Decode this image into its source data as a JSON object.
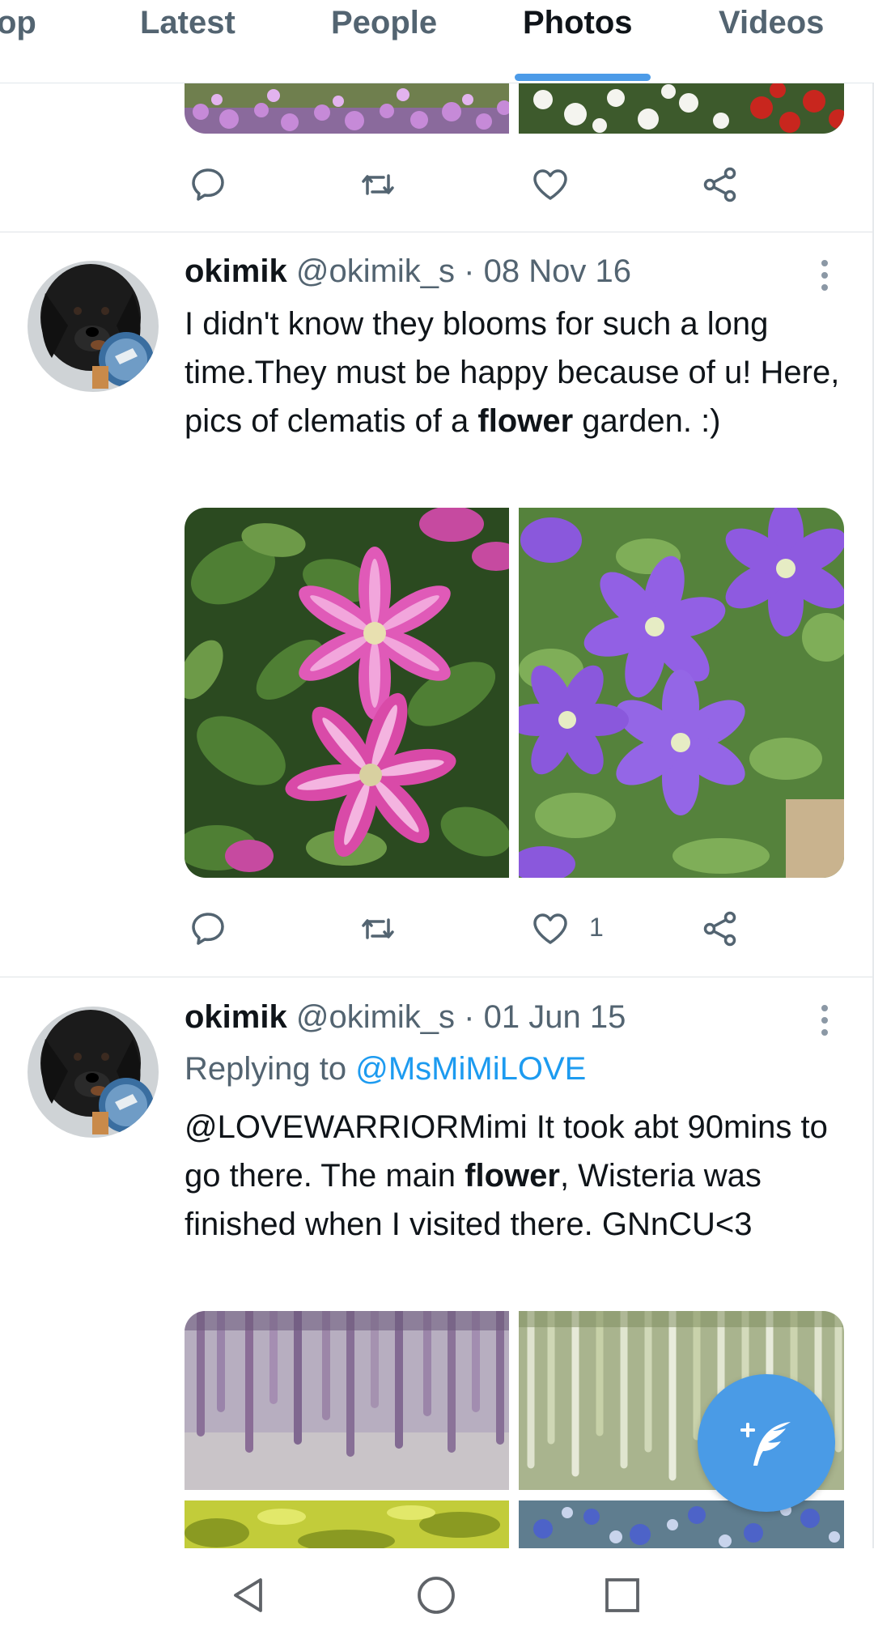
{
  "tabs": [
    {
      "label": "op"
    },
    {
      "label": "Latest"
    },
    {
      "label": "People"
    },
    {
      "label": "Photos",
      "active": true
    },
    {
      "label": "Videos"
    }
  ],
  "tweets": [
    {
      "author": "okimik",
      "handle": "@okimik_s",
      "separator": "·",
      "date": "08 Nov 16",
      "text_parts": [
        "I didn't know they blooms for such a long time.They must be happy because of u! Here, pics of clematis of a ",
        "flower",
        " garden. :)"
      ],
      "photos": [
        "pink-clematis-photo",
        "purple-clematis-photo"
      ],
      "like_count": "1"
    },
    {
      "author": "okimik",
      "handle": "@okimik_s",
      "separator": "·",
      "date": "01 Jun 15",
      "replying_prefix": "Replying to",
      "replying_to": "@MsMiMiLOVE",
      "text_parts": [
        "@LOVEWARRIORMimi It took abt 90mins to go there. The main ",
        "flower",
        ", Wisteria was finished when I visited there. GNnCU<3"
      ],
      "photos": [
        "purple-wisteria-photo",
        "white-wisteria-photo",
        "yellow-foliage-photo",
        "blue-flowers-photo"
      ]
    }
  ],
  "icons": {
    "reply": "speech-bubble-icon",
    "retweet": "retweet-icon",
    "like": "heart-icon",
    "share": "share-icon",
    "more": "vertical-ellipsis-icon",
    "compose": "compose-feather-icon",
    "nav_back": "triangle-back-icon",
    "nav_home": "circle-home-icon",
    "nav_recents": "square-recents-icon"
  },
  "colors": {
    "accent": "#4a9be6",
    "link": "#1d9bf0",
    "secondary_text": "#536471"
  }
}
